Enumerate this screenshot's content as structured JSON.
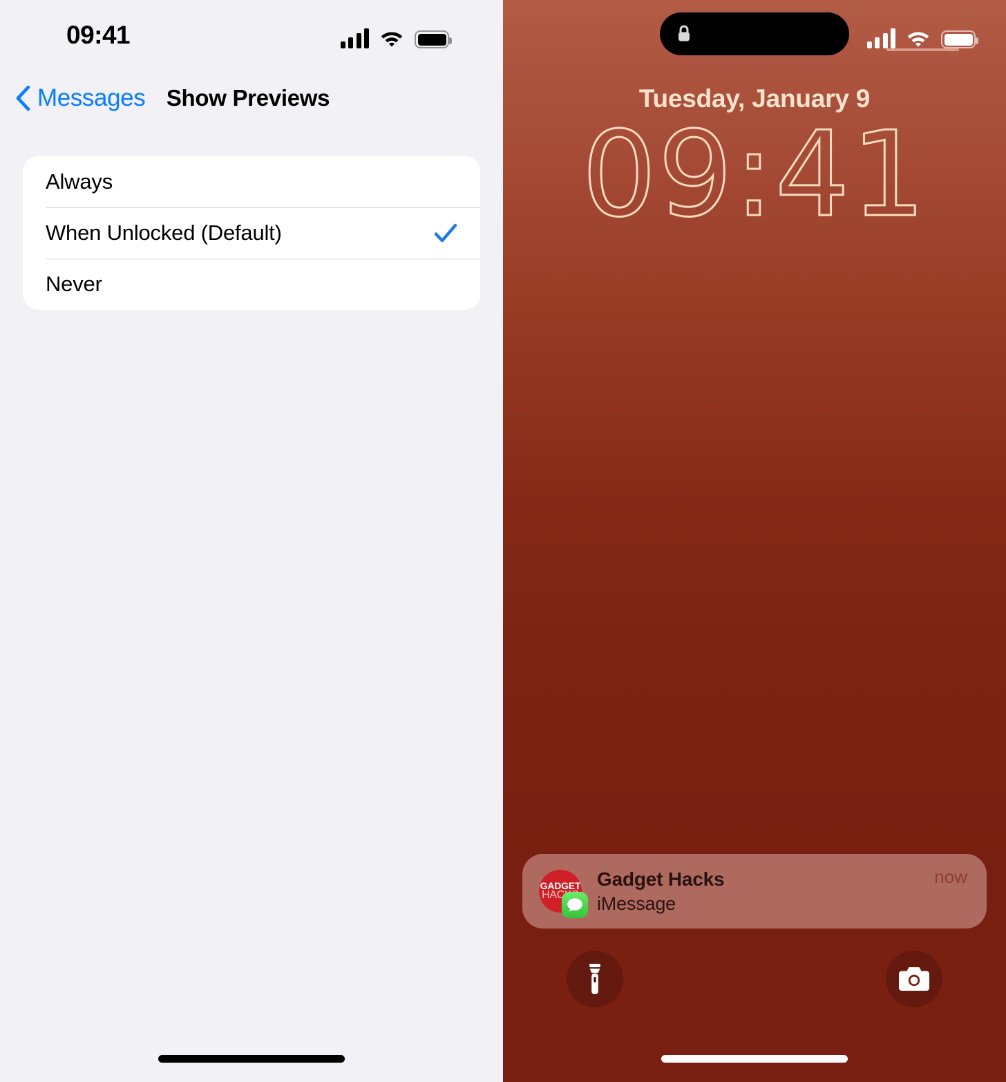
{
  "settings_screen": {
    "status_bar": {
      "time": "09:41",
      "cellular_icon": "cellular-bars-icon",
      "wifi_icon": "wifi-icon",
      "battery_icon": "battery-icon"
    },
    "nav": {
      "back_label": "Messages",
      "back_icon": "chevron-left-icon",
      "title": "Show Previews"
    },
    "options": [
      {
        "label": "Always",
        "selected": false
      },
      {
        "label": "When Unlocked (Default)",
        "selected": true
      },
      {
        "label": "Never",
        "selected": false
      }
    ],
    "selected_option": "When Unlocked (Default)",
    "accent_color": "#0a7cff",
    "background_color": "#f1f1f6",
    "home_indicator": "home-indicator"
  },
  "lock_screen": {
    "status_bar": {
      "dynamic_island_icon": "lock-icon",
      "cellular_icon": "cellular-bars-icon",
      "wifi_icon": "wifi-icon",
      "battery_icon": "battery-icon"
    },
    "date": "Tuesday, January 9",
    "time": "09:41",
    "clock_color": "#fadcc0",
    "wallpaper_top_color": "#b25b45",
    "wallpaper_bottom_color": "#7a2012",
    "notification": {
      "app_icon": "messages-app-icon",
      "avatar_line1": "GADGET",
      "avatar_line2": "HACKS",
      "avatar_color": "#cf2027",
      "title": "Gadget Hacks",
      "subtitle": "iMessage",
      "timestamp": "now"
    },
    "quick_actions": [
      {
        "name": "flashlight-button",
        "icon": "flashlight-icon"
      },
      {
        "name": "camera-button",
        "icon": "camera-icon"
      }
    ],
    "home_indicator": "home-indicator"
  }
}
